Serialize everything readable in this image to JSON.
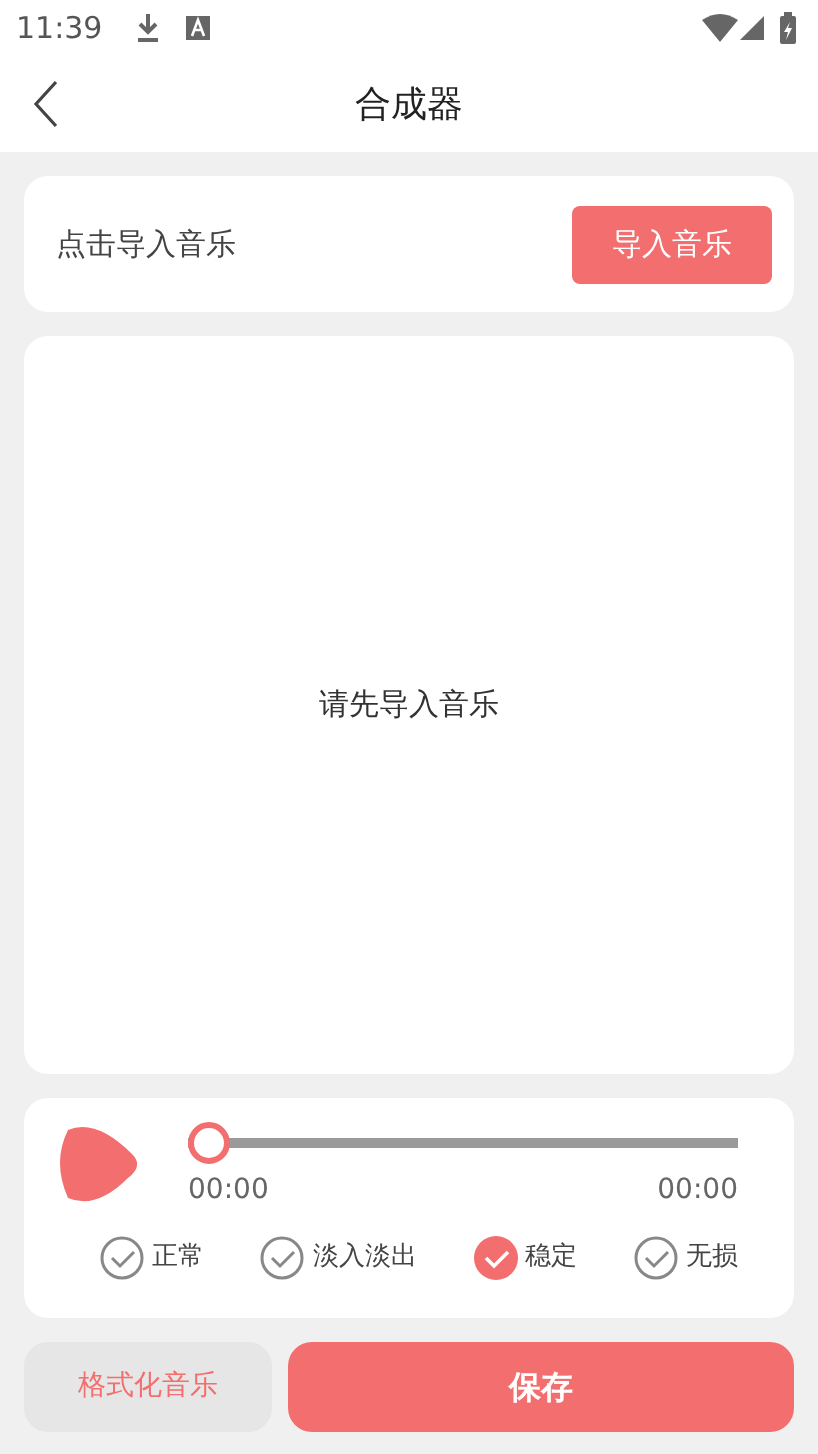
{
  "status_bar": {
    "time": "11:39"
  },
  "header": {
    "title": "合成器"
  },
  "import_card": {
    "label": "点击导入音乐",
    "button": "导入音乐"
  },
  "preview": {
    "message": "请先导入音乐"
  },
  "player": {
    "level": 0,
    "current_time": "00:00",
    "total_time": "00:00"
  },
  "modes": [
    {
      "label": "正常",
      "selected": false
    },
    {
      "label": "淡入淡出",
      "selected": false
    },
    {
      "label": "稳定",
      "selected": true
    },
    {
      "label": "无损",
      "selected": false
    }
  ],
  "actions": {
    "format_button": "格式化音乐",
    "save_button": "保存"
  }
}
